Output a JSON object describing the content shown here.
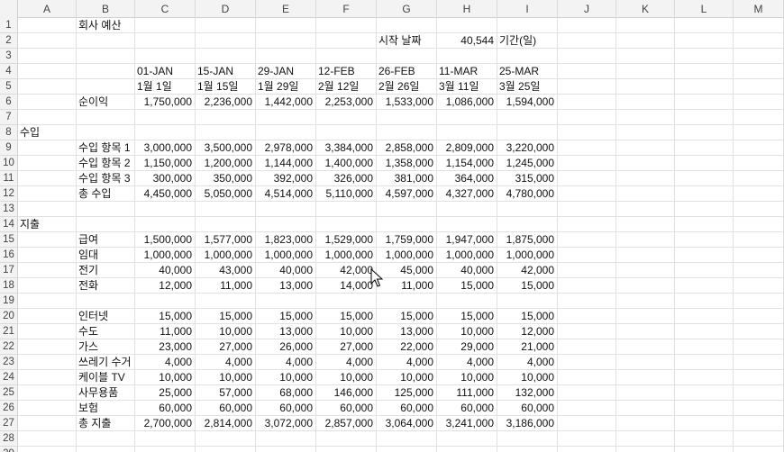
{
  "columns": [
    "A",
    "B",
    "C",
    "D",
    "E",
    "F",
    "G",
    "H",
    "I",
    "J",
    "K",
    "L",
    "M"
  ],
  "rows": [
    {
      "n": "1",
      "cells": {
        "B": "회사 예산"
      }
    },
    {
      "n": "2",
      "cells": {
        "G": "시작 날짜",
        "H": "40,544",
        "I": "기간(일)"
      }
    },
    {
      "n": "3",
      "cells": {}
    },
    {
      "n": "4",
      "cells": {
        "C": "01-JAN",
        "D": "15-JAN",
        "E": "29-JAN",
        "F": "12-FEB",
        "G": "26-FEB",
        "H": "11-MAR",
        "I": "25-MAR"
      }
    },
    {
      "n": "5",
      "cells": {
        "C": "1월 1일",
        "D": "1월 15일",
        "E": "1월 29일",
        "F": "2월 12일",
        "G": "2월 26일",
        "H": "3월 11일",
        "I": "3월 25일"
      }
    },
    {
      "n": "6",
      "cells": {
        "B": "순이익",
        "C": "1,750,000",
        "D": "2,236,000",
        "E": "1,442,000",
        "F": "2,253,000",
        "G": "1,533,000",
        "H": "1,086,000",
        "I": "1,594,000"
      }
    },
    {
      "n": "7",
      "cells": {}
    },
    {
      "n": "8",
      "cells": {
        "A": "수입"
      }
    },
    {
      "n": "9",
      "cells": {
        "B": "수입 항목 1",
        "C": "3,000,000",
        "D": "3,500,000",
        "E": "2,978,000",
        "F": "3,384,000",
        "G": "2,858,000",
        "H": "2,809,000",
        "I": "3,220,000"
      }
    },
    {
      "n": "10",
      "cells": {
        "B": "수입 항목 2",
        "C": "1,150,000",
        "D": "1,200,000",
        "E": "1,144,000",
        "F": "1,400,000",
        "G": "1,358,000",
        "H": "1,154,000",
        "I": "1,245,000"
      }
    },
    {
      "n": "11",
      "cells": {
        "B": "수입 항목 3",
        "C": "300,000",
        "D": "350,000",
        "E": "392,000",
        "F": "326,000",
        "G": "381,000",
        "H": "364,000",
        "I": "315,000"
      }
    },
    {
      "n": "12",
      "cells": {
        "B": "총 수입",
        "C": "4,450,000",
        "D": "5,050,000",
        "E": "4,514,000",
        "F": "5,110,000",
        "G": "4,597,000",
        "H": "4,327,000",
        "I": "4,780,000"
      }
    },
    {
      "n": "13",
      "cells": {}
    },
    {
      "n": "14",
      "cells": {
        "A": "지출"
      }
    },
    {
      "n": "15",
      "cells": {
        "B": "급여",
        "C": "1,500,000",
        "D": "1,577,000",
        "E": "1,823,000",
        "F": "1,529,000",
        "G": "1,759,000",
        "H": "1,947,000",
        "I": "1,875,000"
      }
    },
    {
      "n": "16",
      "cells": {
        "B": "임대",
        "C": "1,000,000",
        "D": "1,000,000",
        "E": "1,000,000",
        "F": "1,000,000",
        "G": "1,000,000",
        "H": "1,000,000",
        "I": "1,000,000"
      }
    },
    {
      "n": "17",
      "cells": {
        "B": "전기",
        "C": "40,000",
        "D": "43,000",
        "E": "40,000",
        "F": "42,000",
        "G": "45,000",
        "H": "40,000",
        "I": "42,000"
      }
    },
    {
      "n": "18",
      "cells": {
        "B": "전화",
        "C": "12,000",
        "D": "11,000",
        "E": "13,000",
        "F": "14,000",
        "G": "11,000",
        "H": "15,000",
        "I": "15,000"
      }
    },
    {
      "n": "19",
      "cells": {}
    },
    {
      "n": "20",
      "cells": {
        "B": "인터넷",
        "C": "15,000",
        "D": "15,000",
        "E": "15,000",
        "F": "15,000",
        "G": "15,000",
        "H": "15,000",
        "I": "15,000"
      }
    },
    {
      "n": "21",
      "cells": {
        "B": "수도",
        "C": "11,000",
        "D": "10,000",
        "E": "13,000",
        "F": "10,000",
        "G": "13,000",
        "H": "10,000",
        "I": "12,000"
      }
    },
    {
      "n": "22",
      "cells": {
        "B": "가스",
        "C": "23,000",
        "D": "27,000",
        "E": "26,000",
        "F": "27,000",
        "G": "22,000",
        "H": "29,000",
        "I": "21,000"
      }
    },
    {
      "n": "23",
      "cells": {
        "B": "쓰레기 수거",
        "C": "4,000",
        "D": "4,000",
        "E": "4,000",
        "F": "4,000",
        "G": "4,000",
        "H": "4,000",
        "I": "4,000"
      }
    },
    {
      "n": "24",
      "cells": {
        "B": "케이블 TV",
        "C": "10,000",
        "D": "10,000",
        "E": "10,000",
        "F": "10,000",
        "G": "10,000",
        "H": "10,000",
        "I": "10,000"
      }
    },
    {
      "n": "25",
      "cells": {
        "B": "사무용품",
        "C": "25,000",
        "D": "57,000",
        "E": "68,000",
        "F": "146,000",
        "G": "125,000",
        "H": "111,000",
        "I": "132,000"
      }
    },
    {
      "n": "26",
      "cells": {
        "B": "보험",
        "C": "60,000",
        "D": "60,000",
        "E": "60,000",
        "F": "60,000",
        "G": "60,000",
        "H": "60,000",
        "I": "60,000"
      }
    },
    {
      "n": "27",
      "cells": {
        "B": "총 지출",
        "C": "2,700,000",
        "D": "2,814,000",
        "E": "3,072,000",
        "F": "2,857,000",
        "G": "3,064,000",
        "H": "3,241,000",
        "I": "3,186,000"
      }
    },
    {
      "n": "28",
      "cells": {}
    },
    {
      "n": "29",
      "cells": {}
    }
  ]
}
